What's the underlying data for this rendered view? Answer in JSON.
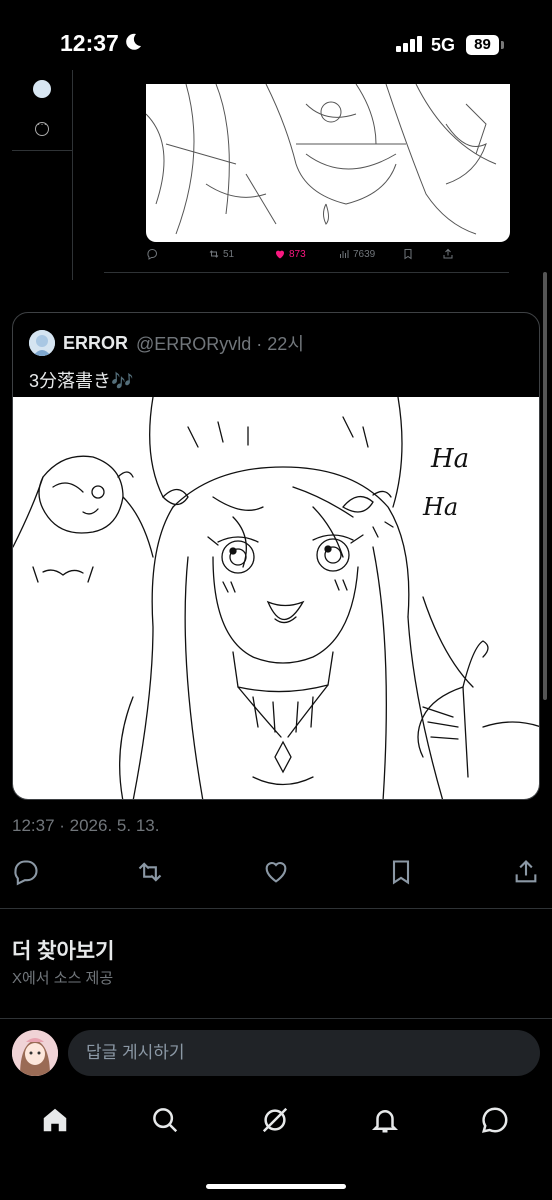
{
  "status_bar": {
    "time": "12:37",
    "network": "5G",
    "battery": "89"
  },
  "previous_tweet": {
    "reposts": "51",
    "likes": "873",
    "views": "7639"
  },
  "quote": {
    "name": "ERROR",
    "handle_time": "@ERRORyvld · 22시",
    "text": "3分落書き🎶",
    "drawing_caption": "Ha Ha"
  },
  "tweet": {
    "timestamp": "12:37 · 2026. 5. 13."
  },
  "more": {
    "title": "더 찾아보기",
    "subtitle": "X에서 소스 제공"
  },
  "reply": {
    "placeholder": "답글 게시하기"
  },
  "tabs": [
    "home",
    "search",
    "grok",
    "notifications",
    "messages"
  ],
  "colors": {
    "like": "#f91880",
    "background": "#000000",
    "muted": "#71767b"
  }
}
